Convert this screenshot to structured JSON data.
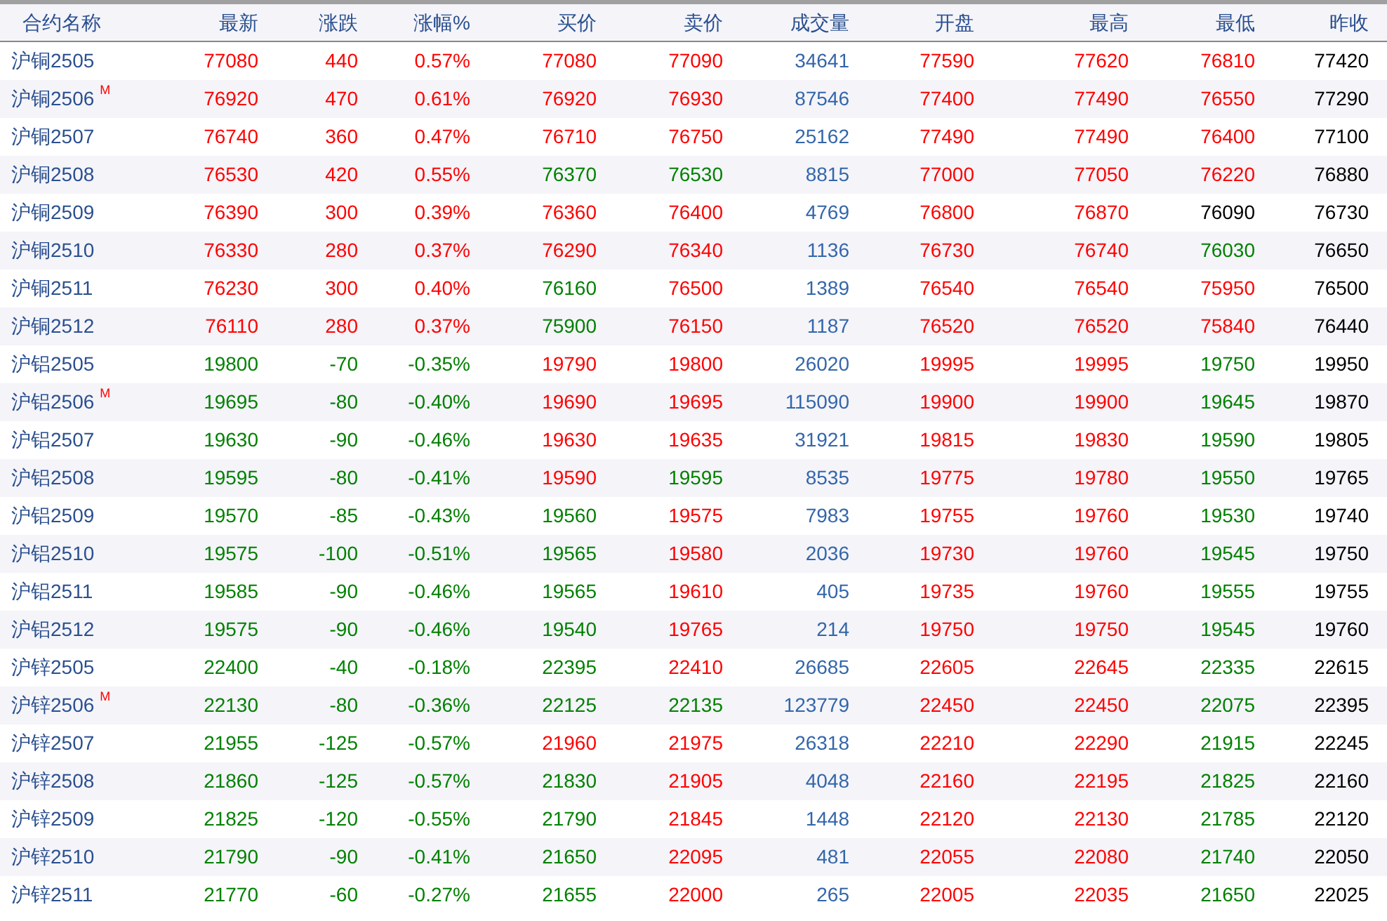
{
  "table": {
    "columns": [
      "合约名称",
      "最新",
      "涨跌",
      "涨幅%",
      "买价",
      "卖价",
      "成交量",
      "开盘",
      "最高",
      "最低",
      "昨收"
    ],
    "rows": [
      {
        "name": "沪铜2505",
        "quotes": [
          {
            "text": "77080",
            "color": "#ff0000"
          },
          {
            "text": "440",
            "color": "#ff0000"
          },
          {
            "text": "0.57%",
            "color": "#ff0000"
          },
          {
            "text": "77080",
            "color": "#ff0000"
          },
          {
            "text": "77090",
            "color": "#ff0000"
          }
        ],
        "volume": "34641",
        "range": [
          {
            "text": "77590",
            "color": "#ff0000"
          },
          {
            "text": "77620",
            "color": "#ff0000"
          },
          {
            "text": "76810",
            "color": "#ff0000"
          }
        ],
        "prev_close": "77420"
      },
      {
        "name": "沪铜2506",
        "badge": "M",
        "quotes": [
          {
            "text": "76920",
            "color": "#ff0000"
          },
          {
            "text": "470",
            "color": "#ff0000"
          },
          {
            "text": "0.61%",
            "color": "#ff0000"
          },
          {
            "text": "76920",
            "color": "#ff0000"
          },
          {
            "text": "76930",
            "color": "#ff0000"
          }
        ],
        "volume": "87546",
        "range": [
          {
            "text": "77400",
            "color": "#ff0000"
          },
          {
            "text": "77490",
            "color": "#ff0000"
          },
          {
            "text": "76550",
            "color": "#ff0000"
          }
        ],
        "prev_close": "77290"
      },
      {
        "name": "沪铜2507",
        "quotes": [
          {
            "text": "76740",
            "color": "#ff0000"
          },
          {
            "text": "360",
            "color": "#ff0000"
          },
          {
            "text": "0.47%",
            "color": "#ff0000"
          },
          {
            "text": "76710",
            "color": "#ff0000"
          },
          {
            "text": "76750",
            "color": "#ff0000"
          }
        ],
        "volume": "25162",
        "range": [
          {
            "text": "77490",
            "color": "#ff0000"
          },
          {
            "text": "77490",
            "color": "#ff0000"
          },
          {
            "text": "76400",
            "color": "#ff0000"
          }
        ],
        "prev_close": "77100"
      },
      {
        "name": "沪铜2508",
        "quotes": [
          {
            "text": "76530",
            "color": "#ff0000"
          },
          {
            "text": "420",
            "color": "#ff0000"
          },
          {
            "text": "0.55%",
            "color": "#ff0000"
          },
          {
            "text": "76370",
            "color": "#008000"
          },
          {
            "text": "76530",
            "color": "#008000"
          }
        ],
        "volume": "8815",
        "range": [
          {
            "text": "77000",
            "color": "#ff0000"
          },
          {
            "text": "77050",
            "color": "#ff0000"
          },
          {
            "text": "76220",
            "color": "#ff0000"
          }
        ],
        "prev_close": "76880"
      },
      {
        "name": "沪铜2509",
        "quotes": [
          {
            "text": "76390",
            "color": "#ff0000"
          },
          {
            "text": "300",
            "color": "#ff0000"
          },
          {
            "text": "0.39%",
            "color": "#ff0000"
          },
          {
            "text": "76360",
            "color": "#ff0000"
          },
          {
            "text": "76400",
            "color": "#ff0000"
          }
        ],
        "volume": "4769",
        "range": [
          {
            "text": "76800",
            "color": "#ff0000"
          },
          {
            "text": "76870",
            "color": "#ff0000"
          },
          {
            "text": "76090",
            "color": "#000000"
          }
        ],
        "prev_close": "76730"
      },
      {
        "name": "沪铜2510",
        "quotes": [
          {
            "text": "76330",
            "color": "#ff0000"
          },
          {
            "text": "280",
            "color": "#ff0000"
          },
          {
            "text": "0.37%",
            "color": "#ff0000"
          },
          {
            "text": "76290",
            "color": "#ff0000"
          },
          {
            "text": "76340",
            "color": "#ff0000"
          }
        ],
        "volume": "1136",
        "range": [
          {
            "text": "76730",
            "color": "#ff0000"
          },
          {
            "text": "76740",
            "color": "#ff0000"
          },
          {
            "text": "76030",
            "color": "#008000"
          }
        ],
        "prev_close": "76650"
      },
      {
        "name": "沪铜2511",
        "quotes": [
          {
            "text": "76230",
            "color": "#ff0000"
          },
          {
            "text": "300",
            "color": "#ff0000"
          },
          {
            "text": "0.40%",
            "color": "#ff0000"
          },
          {
            "text": "76160",
            "color": "#008000"
          },
          {
            "text": "76500",
            "color": "#ff0000"
          }
        ],
        "volume": "1389",
        "range": [
          {
            "text": "76540",
            "color": "#ff0000"
          },
          {
            "text": "76540",
            "color": "#ff0000"
          },
          {
            "text": "75950",
            "color": "#ff0000"
          }
        ],
        "prev_close": "76500"
      },
      {
        "name": "沪铜2512",
        "quotes": [
          {
            "text": "76110",
            "color": "#ff0000"
          },
          {
            "text": "280",
            "color": "#ff0000"
          },
          {
            "text": "0.37%",
            "color": "#ff0000"
          },
          {
            "text": "75900",
            "color": "#008000"
          },
          {
            "text": "76150",
            "color": "#ff0000"
          }
        ],
        "volume": "1187",
        "range": [
          {
            "text": "76520",
            "color": "#ff0000"
          },
          {
            "text": "76520",
            "color": "#ff0000"
          },
          {
            "text": "75840",
            "color": "#ff0000"
          }
        ],
        "prev_close": "76440"
      },
      {
        "name": "沪铝2505",
        "quotes": [
          {
            "text": "19800",
            "color": "#008000"
          },
          {
            "text": "-70",
            "color": "#008000"
          },
          {
            "text": "-0.35%",
            "color": "#008000"
          },
          {
            "text": "19790",
            "color": "#ff0000"
          },
          {
            "text": "19800",
            "color": "#ff0000"
          }
        ],
        "volume": "26020",
        "range": [
          {
            "text": "19995",
            "color": "#ff0000"
          },
          {
            "text": "19995",
            "color": "#ff0000"
          },
          {
            "text": "19750",
            "color": "#008000"
          }
        ],
        "prev_close": "19950"
      },
      {
        "name": "沪铝2506",
        "badge": "M",
        "quotes": [
          {
            "text": "19695",
            "color": "#008000"
          },
          {
            "text": "-80",
            "color": "#008000"
          },
          {
            "text": "-0.40%",
            "color": "#008000"
          },
          {
            "text": "19690",
            "color": "#ff0000"
          },
          {
            "text": "19695",
            "color": "#ff0000"
          }
        ],
        "volume": "115090",
        "range": [
          {
            "text": "19900",
            "color": "#ff0000"
          },
          {
            "text": "19900",
            "color": "#ff0000"
          },
          {
            "text": "19645",
            "color": "#008000"
          }
        ],
        "prev_close": "19870"
      },
      {
        "name": "沪铝2507",
        "quotes": [
          {
            "text": "19630",
            "color": "#008000"
          },
          {
            "text": "-90",
            "color": "#008000"
          },
          {
            "text": "-0.46%",
            "color": "#008000"
          },
          {
            "text": "19630",
            "color": "#ff0000"
          },
          {
            "text": "19635",
            "color": "#ff0000"
          }
        ],
        "volume": "31921",
        "range": [
          {
            "text": "19815",
            "color": "#ff0000"
          },
          {
            "text": "19830",
            "color": "#ff0000"
          },
          {
            "text": "19590",
            "color": "#008000"
          }
        ],
        "prev_close": "19805"
      },
      {
        "name": "沪铝2508",
        "quotes": [
          {
            "text": "19595",
            "color": "#008000"
          },
          {
            "text": "-80",
            "color": "#008000"
          },
          {
            "text": "-0.41%",
            "color": "#008000"
          },
          {
            "text": "19590",
            "color": "#ff0000"
          },
          {
            "text": "19595",
            "color": "#008000"
          }
        ],
        "volume": "8535",
        "range": [
          {
            "text": "19775",
            "color": "#ff0000"
          },
          {
            "text": "19780",
            "color": "#ff0000"
          },
          {
            "text": "19550",
            "color": "#008000"
          }
        ],
        "prev_close": "19765"
      },
      {
        "name": "沪铝2509",
        "quotes": [
          {
            "text": "19570",
            "color": "#008000"
          },
          {
            "text": "-85",
            "color": "#008000"
          },
          {
            "text": "-0.43%",
            "color": "#008000"
          },
          {
            "text": "19560",
            "color": "#008000"
          },
          {
            "text": "19575",
            "color": "#ff0000"
          }
        ],
        "volume": "7983",
        "range": [
          {
            "text": "19755",
            "color": "#ff0000"
          },
          {
            "text": "19760",
            "color": "#ff0000"
          },
          {
            "text": "19530",
            "color": "#008000"
          }
        ],
        "prev_close": "19740"
      },
      {
        "name": "沪铝2510",
        "quotes": [
          {
            "text": "19575",
            "color": "#008000"
          },
          {
            "text": "-100",
            "color": "#008000"
          },
          {
            "text": "-0.51%",
            "color": "#008000"
          },
          {
            "text": "19565",
            "color": "#008000"
          },
          {
            "text": "19580",
            "color": "#ff0000"
          }
        ],
        "volume": "2036",
        "range": [
          {
            "text": "19730",
            "color": "#ff0000"
          },
          {
            "text": "19760",
            "color": "#ff0000"
          },
          {
            "text": "19545",
            "color": "#008000"
          }
        ],
        "prev_close": "19750"
      },
      {
        "name": "沪铝2511",
        "quotes": [
          {
            "text": "19585",
            "color": "#008000"
          },
          {
            "text": "-90",
            "color": "#008000"
          },
          {
            "text": "-0.46%",
            "color": "#008000"
          },
          {
            "text": "19565",
            "color": "#008000"
          },
          {
            "text": "19610",
            "color": "#ff0000"
          }
        ],
        "volume": "405",
        "range": [
          {
            "text": "19735",
            "color": "#ff0000"
          },
          {
            "text": "19760",
            "color": "#ff0000"
          },
          {
            "text": "19555",
            "color": "#008000"
          }
        ],
        "prev_close": "19755"
      },
      {
        "name": "沪铝2512",
        "quotes": [
          {
            "text": "19575",
            "color": "#008000"
          },
          {
            "text": "-90",
            "color": "#008000"
          },
          {
            "text": "-0.46%",
            "color": "#008000"
          },
          {
            "text": "19540",
            "color": "#008000"
          },
          {
            "text": "19765",
            "color": "#ff0000"
          }
        ],
        "volume": "214",
        "range": [
          {
            "text": "19750",
            "color": "#ff0000"
          },
          {
            "text": "19750",
            "color": "#ff0000"
          },
          {
            "text": "19545",
            "color": "#008000"
          }
        ],
        "prev_close": "19760"
      },
      {
        "name": "沪锌2505",
        "quotes": [
          {
            "text": "22400",
            "color": "#008000"
          },
          {
            "text": "-40",
            "color": "#008000"
          },
          {
            "text": "-0.18%",
            "color": "#008000"
          },
          {
            "text": "22395",
            "color": "#008000"
          },
          {
            "text": "22410",
            "color": "#ff0000"
          }
        ],
        "volume": "26685",
        "range": [
          {
            "text": "22605",
            "color": "#ff0000"
          },
          {
            "text": "22645",
            "color": "#ff0000"
          },
          {
            "text": "22335",
            "color": "#008000"
          }
        ],
        "prev_close": "22615"
      },
      {
        "name": "沪锌2506",
        "badge": "M",
        "quotes": [
          {
            "text": "22130",
            "color": "#008000"
          },
          {
            "text": "-80",
            "color": "#008000"
          },
          {
            "text": "-0.36%",
            "color": "#008000"
          },
          {
            "text": "22125",
            "color": "#008000"
          },
          {
            "text": "22135",
            "color": "#008000"
          }
        ],
        "volume": "123779",
        "range": [
          {
            "text": "22450",
            "color": "#ff0000"
          },
          {
            "text": "22450",
            "color": "#ff0000"
          },
          {
            "text": "22075",
            "color": "#008000"
          }
        ],
        "prev_close": "22395"
      },
      {
        "name": "沪锌2507",
        "quotes": [
          {
            "text": "21955",
            "color": "#008000"
          },
          {
            "text": "-125",
            "color": "#008000"
          },
          {
            "text": "-0.57%",
            "color": "#008000"
          },
          {
            "text": "21960",
            "color": "#ff0000"
          },
          {
            "text": "21975",
            "color": "#ff0000"
          }
        ],
        "volume": "26318",
        "range": [
          {
            "text": "22210",
            "color": "#ff0000"
          },
          {
            "text": "22290",
            "color": "#ff0000"
          },
          {
            "text": "21915",
            "color": "#008000"
          }
        ],
        "prev_close": "22245"
      },
      {
        "name": "沪锌2508",
        "quotes": [
          {
            "text": "21860",
            "color": "#008000"
          },
          {
            "text": "-125",
            "color": "#008000"
          },
          {
            "text": "-0.57%",
            "color": "#008000"
          },
          {
            "text": "21830",
            "color": "#008000"
          },
          {
            "text": "21905",
            "color": "#ff0000"
          }
        ],
        "volume": "4048",
        "range": [
          {
            "text": "22160",
            "color": "#ff0000"
          },
          {
            "text": "22195",
            "color": "#ff0000"
          },
          {
            "text": "21825",
            "color": "#008000"
          }
        ],
        "prev_close": "22160"
      },
      {
        "name": "沪锌2509",
        "quotes": [
          {
            "text": "21825",
            "color": "#008000"
          },
          {
            "text": "-120",
            "color": "#008000"
          },
          {
            "text": "-0.55%",
            "color": "#008000"
          },
          {
            "text": "21790",
            "color": "#008000"
          },
          {
            "text": "21845",
            "color": "#ff0000"
          }
        ],
        "volume": "1448",
        "range": [
          {
            "text": "22120",
            "color": "#ff0000"
          },
          {
            "text": "22130",
            "color": "#ff0000"
          },
          {
            "text": "21785",
            "color": "#008000"
          }
        ],
        "prev_close": "22120"
      },
      {
        "name": "沪锌2510",
        "quotes": [
          {
            "text": "21790",
            "color": "#008000"
          },
          {
            "text": "-90",
            "color": "#008000"
          },
          {
            "text": "-0.41%",
            "color": "#008000"
          },
          {
            "text": "21650",
            "color": "#008000"
          },
          {
            "text": "22095",
            "color": "#ff0000"
          }
        ],
        "volume": "481",
        "range": [
          {
            "text": "22055",
            "color": "#ff0000"
          },
          {
            "text": "22080",
            "color": "#ff0000"
          },
          {
            "text": "21740",
            "color": "#008000"
          }
        ],
        "prev_close": "22050"
      },
      {
        "name": "沪锌2511",
        "quotes": [
          {
            "text": "21770",
            "color": "#008000"
          },
          {
            "text": "-60",
            "color": "#008000"
          },
          {
            "text": "-0.27%",
            "color": "#008000"
          },
          {
            "text": "21655",
            "color": "#008000"
          },
          {
            "text": "22000",
            "color": "#ff0000"
          }
        ],
        "volume": "265",
        "range": [
          {
            "text": "22005",
            "color": "#ff0000"
          },
          {
            "text": "22035",
            "color": "#ff0000"
          },
          {
            "text": "21650",
            "color": "#008000"
          }
        ],
        "prev_close": "22025"
      }
    ]
  }
}
